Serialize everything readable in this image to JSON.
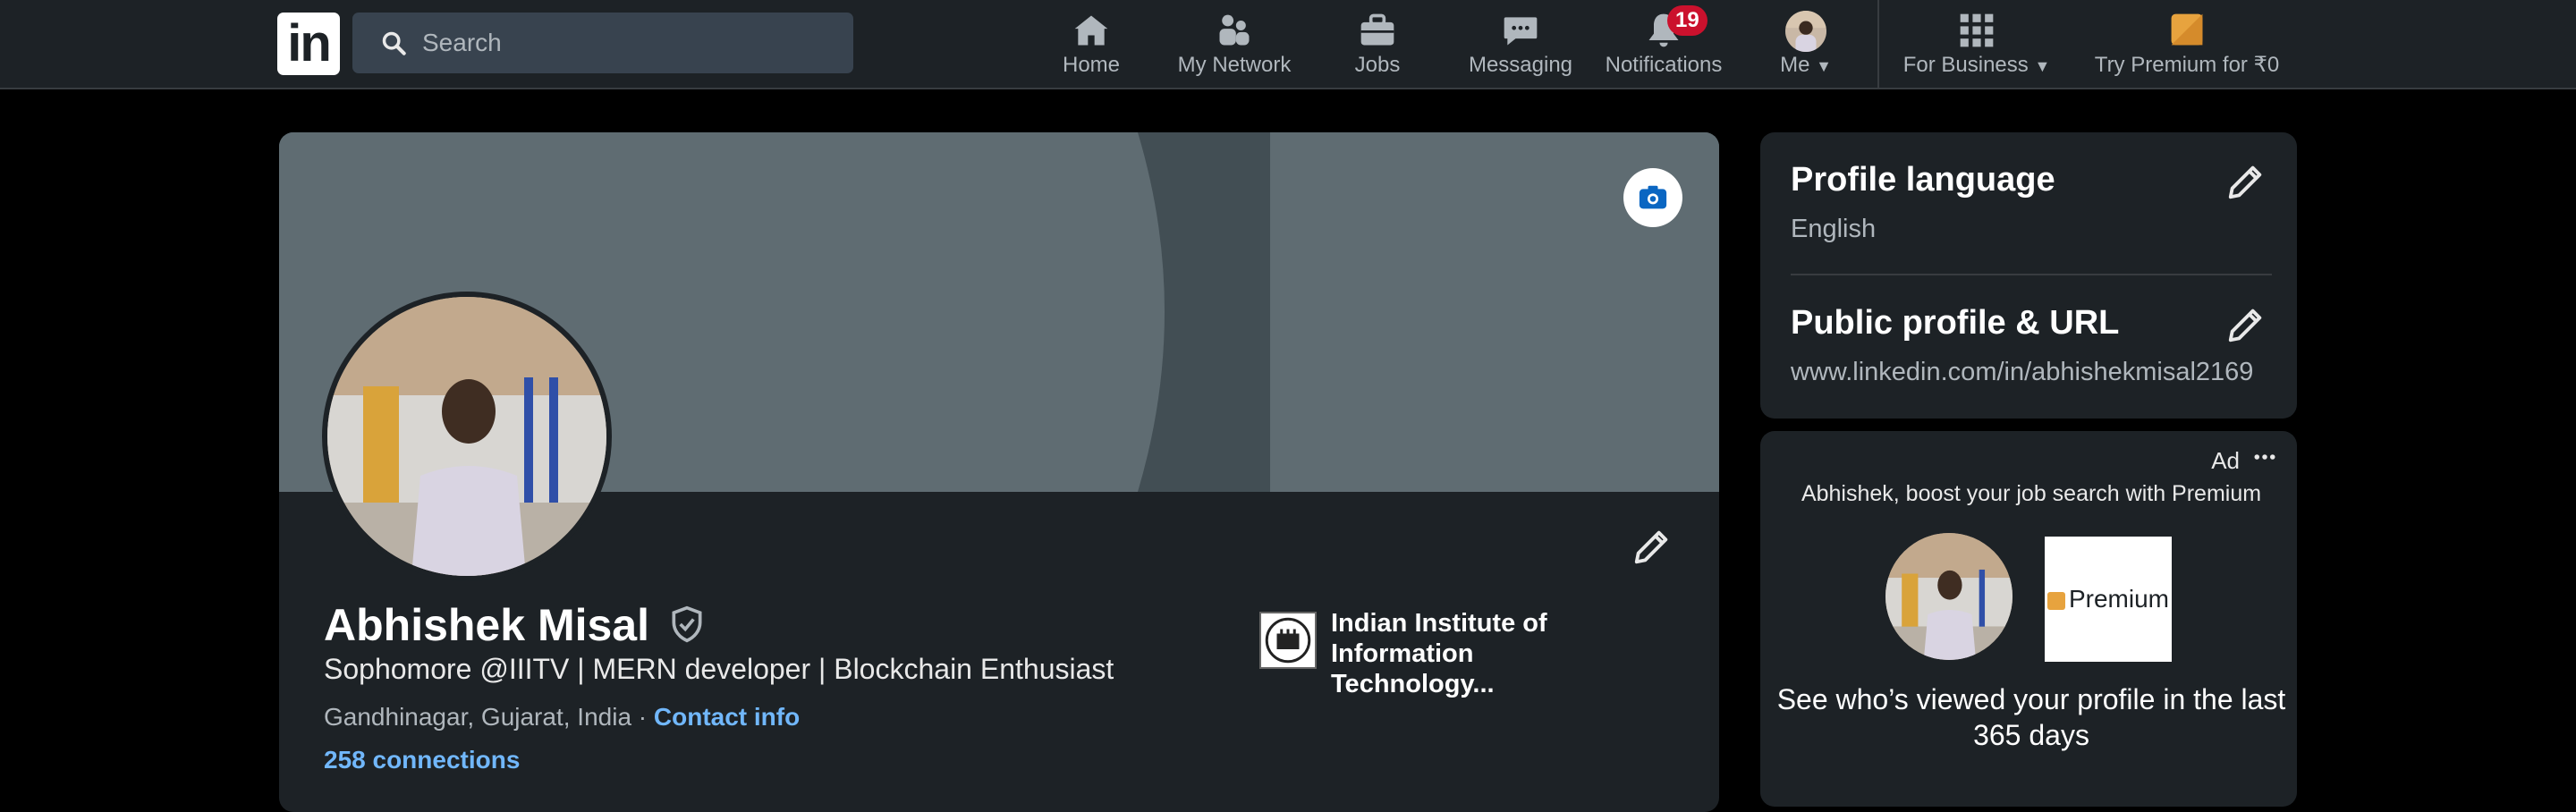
{
  "topbar": {
    "logo_text": "in",
    "search": {
      "placeholder": "Search",
      "icon": "search-icon"
    },
    "nav": [
      {
        "id": "home",
        "label": "Home",
        "icon": "home-icon"
      },
      {
        "id": "network",
        "label": "My Network",
        "icon": "people-icon"
      },
      {
        "id": "jobs",
        "label": "Jobs",
        "icon": "briefcase-icon"
      },
      {
        "id": "messaging",
        "label": "Messaging",
        "icon": "chat-icon"
      },
      {
        "id": "notifications",
        "label": "Notifications",
        "icon": "bell-icon",
        "badge": "19"
      },
      {
        "id": "me",
        "label": "Me",
        "icon": "avatar-icon"
      },
      {
        "id": "business",
        "label": "For Business",
        "icon": "grid-icon"
      },
      {
        "id": "premium",
        "label": "Try Premium for ₹0",
        "icon": "premium-icon"
      }
    ]
  },
  "profile": {
    "name": "Abhishek Misal",
    "headline": "Sophomore @IIITV | MERN developer | Blockchain Enthusiast",
    "location": "Gandhinagar, Gujarat, India",
    "separator": " · ",
    "contact_info": "Contact info",
    "connections": "258 connections",
    "education": "Indian Institute of Information Technology..."
  },
  "sidebar": {
    "language_title": "Profile language",
    "language_value": "English",
    "url_title": "Public profile & URL",
    "url_value": "www.linkedin.com/in/abhishekmisal2169"
  },
  "ad": {
    "label": "Ad",
    "tagline": "Abhishek, boost your job search with Premium",
    "premium_label": "Premium",
    "headline": "See who’s viewed your profile in the last 365 days"
  },
  "colors": {
    "bg": "#000000",
    "card": "#1d2226",
    "link": "#71b7fb",
    "badge": "#cb112d",
    "premium_gold": "#e7a33e"
  }
}
